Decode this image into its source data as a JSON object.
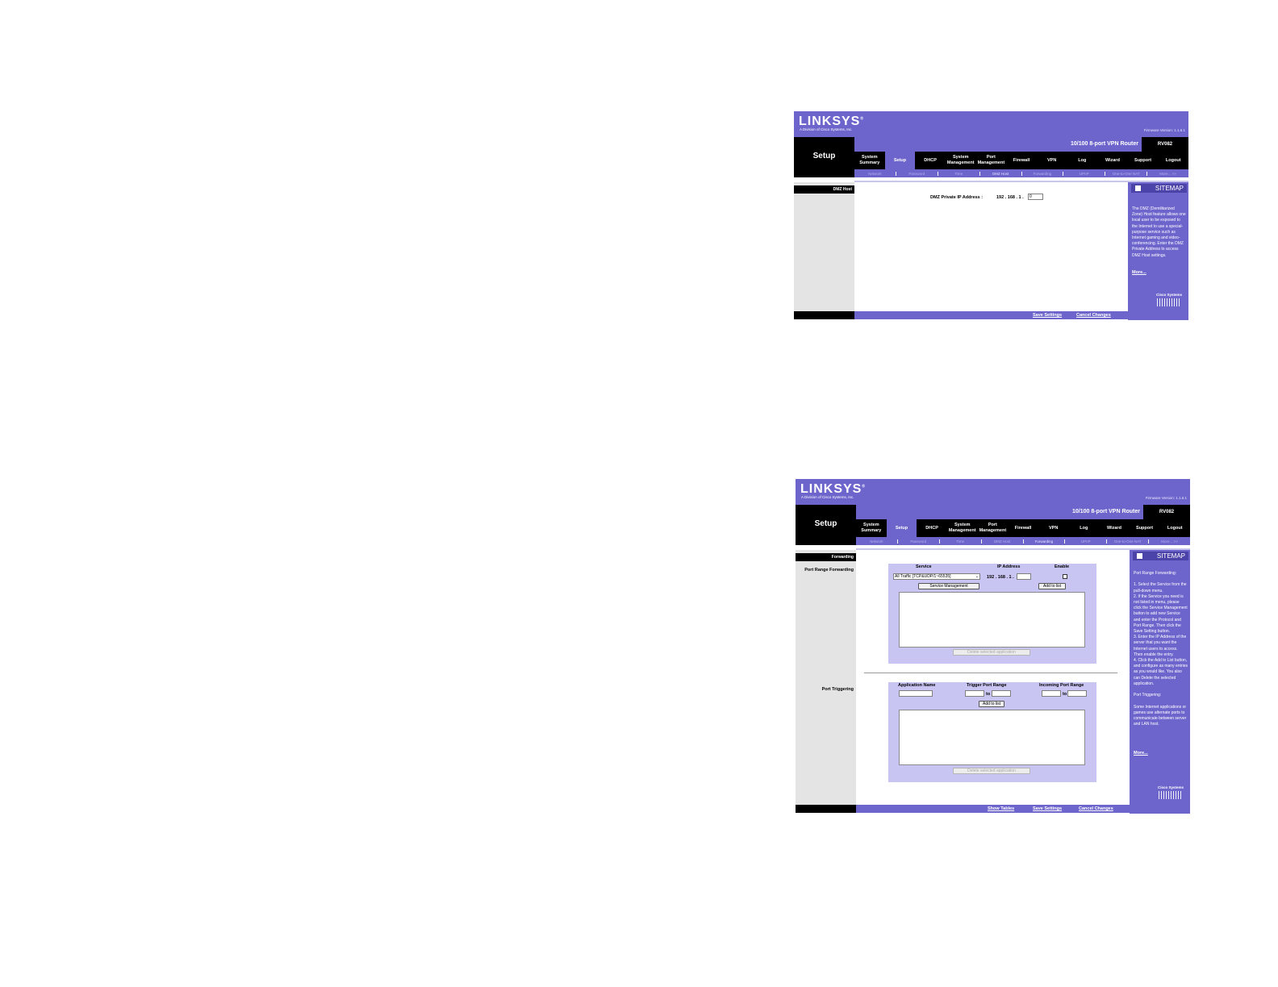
{
  "screens": [
    {
      "brand": {
        "logo": "LINKSYS",
        "registered": "®",
        "sub": "A Division of Cisco Systems, Inc.",
        "firmware": "Firmware Version: 1.1.6.1"
      },
      "product": "10/100 8-port VPN Router",
      "model": "RV082",
      "section": "Setup",
      "tabs": [
        "System Summary",
        "Setup",
        "DHCP",
        "System Management",
        "Port Management",
        "Firewall",
        "VPN",
        "Log",
        "Wizard",
        "Support",
        "Logout"
      ],
      "active_tab": "Setup",
      "subtabs": [
        "Network",
        "Password",
        "Time",
        "DMZ Host",
        "Forwarding",
        "UPnP",
        "One-to-One NAT",
        "More...  >>"
      ],
      "active_subtab": "DMZ Host",
      "page_head": "DMZ Host",
      "dmz": {
        "label": "DMZ Private IP Address :",
        "prefix": "192 . 168 . 1 .",
        "value": "0"
      },
      "sitemap": {
        "title": "SITEMAP",
        "text": "The DMZ (Demilitarized Zone) Host feature allows one local user to be exposed to the Internet to use a special-purpose service such as Internet gaming and video-conferencing. Enter the DMZ Private Address to access DMZ Host settings.",
        "more": "More..."
      },
      "cisco": "Cisco Systems",
      "footer": {
        "save": "Save Settings",
        "cancel": "Cancel Changes"
      }
    },
    {
      "brand": {
        "logo": "LINKSYS",
        "registered": "®",
        "sub": "A Division of Cisco Systems, Inc.",
        "firmware": "Firmware Version: 1.1.6.1"
      },
      "product": "10/100 8-port VPN Router",
      "model": "RV082",
      "section": "Setup",
      "tabs": [
        "System Summary",
        "Setup",
        "DHCP",
        "System Management",
        "Port Management",
        "Firewall",
        "VPN",
        "Log",
        "Wizard",
        "Support",
        "Logout"
      ],
      "active_tab": "Setup",
      "subtabs": [
        "Network",
        "Password",
        "Time",
        "DMZ Host",
        "Forwarding",
        "UPnP",
        "One-to-One NAT",
        "More...  >>"
      ],
      "active_subtab": "Forwarding",
      "page_head": "Forwarding",
      "port_range": {
        "label": "Port Range Forwarding",
        "col_service": "Service",
        "col_ip": "IP Address",
        "col_enable": "Enable",
        "service_value": "All Traffic [TCP&UDP/1~65535]",
        "ip_prefix": "192 . 168 . 1 .",
        "service_mgmt": "Service Management",
        "add": "Add to list",
        "delete": "Delete selected application"
      },
      "port_trigger": {
        "label": "Port Triggering",
        "col_app": "Application Name",
        "col_trigger": "Trigger Port Range",
        "col_incoming": "Incoming Port Range",
        "to": "to",
        "add": "Add to list",
        "delete": "Delete selected application"
      },
      "sitemap": {
        "title": "SITEMAP",
        "text": "Port Range Forwarding:\n\n1. Select the Service from the pull-down menu.\n2. If the Service you need is not listed in menu, please click the Service Management button to add new Service and enter the Protocol and Port Range. Then click the Save Setting button.\n3. Enter the IP Address of the server that you want the Internet users to access. Then enable the entry.\n4. Click the Add to List button, and configure as many entries as you would like. You also can Delete the selected application.\n\nPort Triggering:\n\nSome Internet applications or games use alternate ports to communicate between server and LAN host.",
        "more": "More..."
      },
      "cisco": "Cisco Systems",
      "footer": {
        "show": "Show Tables",
        "save": "Save Settings",
        "cancel": "Cancel Changes"
      }
    }
  ]
}
